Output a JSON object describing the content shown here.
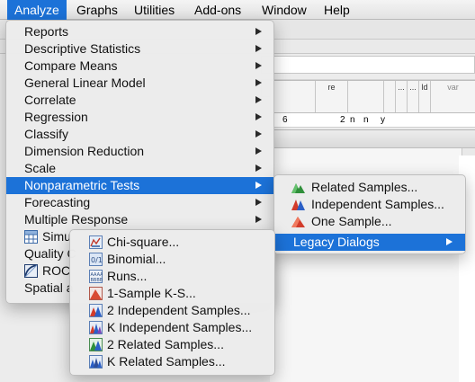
{
  "menubar": {
    "items": [
      "Analyze",
      "Graphs",
      "Utilities",
      "Add-ons",
      "Window",
      "Help"
    ]
  },
  "background": {
    "grid_headers": [
      "re",
      "...",
      "...",
      "ld",
      "var"
    ],
    "grid_row": [
      "6",
      "2",
      "n",
      "n",
      "y"
    ]
  },
  "analyze_menu": {
    "items": [
      "Reports",
      "Descriptive Statistics",
      "Compare Means",
      "General Linear Model",
      "Correlate",
      "Regression",
      "Classify",
      "Dimension Reduction",
      "Scale",
      "Nonparametric Tests",
      "Forecasting",
      "Multiple Response",
      "Simu",
      "Quality C",
      "ROC",
      "Spatial a"
    ]
  },
  "nonparam_menu": {
    "items": [
      "Related Samples...",
      "Independent Samples...",
      "One Sample...",
      "Legacy Dialogs"
    ]
  },
  "legacy_menu": {
    "items": [
      "Chi-square...",
      "Binomial...",
      "Runs...",
      "1-Sample K-S...",
      "2 Independent Samples...",
      "K Independent Samples...",
      "2 Related Samples...",
      "K Related Samples..."
    ]
  },
  "icons": {
    "related": "green-mountain-icon",
    "independent": "red-blue-mountain-icon",
    "one_sample": "red-mountain-icon",
    "chi_square": "chi-square-icon",
    "binomial": "binomial-icon",
    "runs": "runs-icon",
    "ks": "ks-icon",
    "two_indep": "two-independent-icon",
    "k_indep": "k-independent-icon",
    "two_related": "two-related-icon",
    "k_related": "k-related-icon"
  },
  "colors": {
    "highlight": "#1c72d8",
    "menu_bg": "#ececec"
  }
}
